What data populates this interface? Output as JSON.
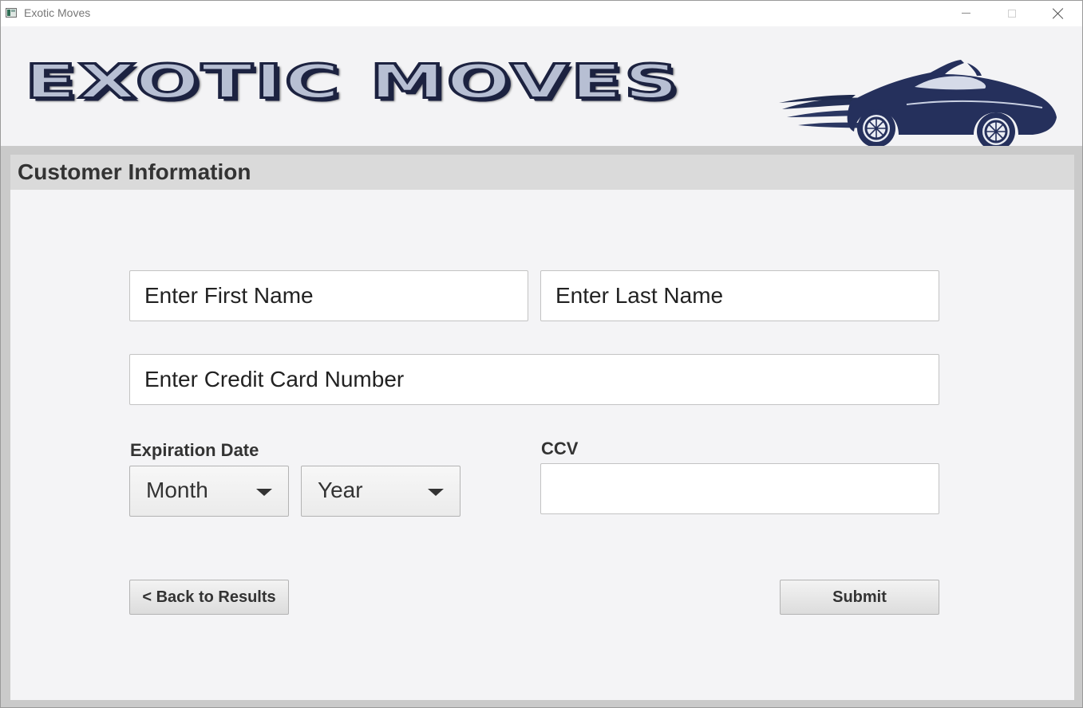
{
  "window": {
    "title": "Exotic Moves"
  },
  "banner": {
    "logo_text": "EXOTIC MOVES",
    "logo_icon": "sports-car-icon",
    "logo_color": "#1c2240"
  },
  "section": {
    "title": "Customer Information"
  },
  "form": {
    "first_name": {
      "value": "",
      "placeholder": "Enter First Name"
    },
    "last_name": {
      "value": "",
      "placeholder": "Enter Last Name"
    },
    "credit_card": {
      "value": "",
      "placeholder": "Enter Credit Card Number"
    },
    "expiration_label": "Expiration Date",
    "month": {
      "selected": "Month"
    },
    "year": {
      "selected": "Year"
    },
    "ccv_label": "CCV",
    "ccv": {
      "value": "",
      "placeholder": ""
    }
  },
  "actions": {
    "back_label": "< Back to Results",
    "submit_label": "Submit"
  }
}
